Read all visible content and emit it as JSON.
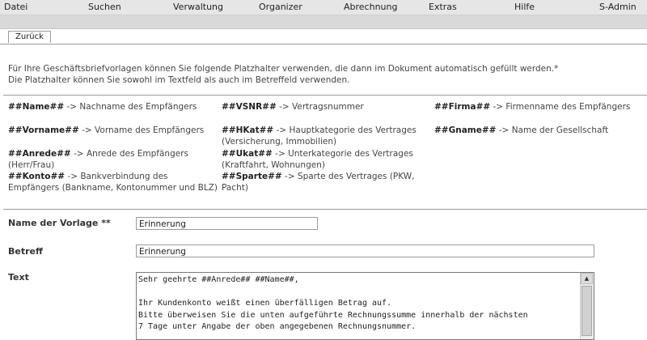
{
  "menu": {
    "items": [
      "Datei",
      "Suchen",
      "Verwaltung",
      "Organizer",
      "Abrechnung",
      "Extras",
      "Hilfe",
      "S-Admin"
    ]
  },
  "tabs": {
    "back_label": "Zurück"
  },
  "intro": {
    "line1": "Für Ihre Geschäftsbriefvorlagen können Sie folgende Platzhalter verwenden, die dann im Dokument automatisch gefüllt werden.*",
    "line2": "Die Platzhalter können Sie sowohl im Textfeld als auch im Betreffeld verwenden."
  },
  "placeholders": [
    {
      "key": "##Name##",
      "desc": " -> Nachname des Empfängers"
    },
    {
      "key": "##VSNR##",
      "desc": " -> Vertragsnummer"
    },
    {
      "key": "##Firma##",
      "desc": " -> Firmenname des Empfängers"
    },
    {
      "key": "##Vorname##",
      "desc": " -> Vorname des Empfängers"
    },
    {
      "key": "##HKat##",
      "desc": " -> Hauptkategorie des Vertrages (Versicherung, Immobilien)"
    },
    {
      "key": "##Gname##",
      "desc": " -> Name der Gesellschaft"
    },
    {
      "key": "##Anrede##",
      "desc": " -> Anrede des Empfängers (Herr/Frau)"
    },
    {
      "key": "##Ukat##",
      "desc": " -> Unterkategorie des Vertrages (Kraftfahrt, Wohnungen)"
    },
    {
      "key": "##Konto##",
      "desc": " -> Bankverbindung des Empfängers (Bankname, Kontonummer und BLZ)"
    },
    {
      "key": "##Sparte##",
      "desc": " -> Sparte des Vertrages (PKW, Pacht)"
    }
  ],
  "form": {
    "name_label": "Name der Vorlage **",
    "name_value": "Erinnerung",
    "subject_label": "Betreff",
    "subject_value": "Erinnerung",
    "text_label": "Text",
    "text_value": "Sehr geehrte ##Anrede## ##Name##,\n\nIhr Kundenkonto weißt einen überfälligen Betrag auf.\nBitte überweisen Sie die unten aufgeführte Rechnungssumme innerhalb der nächsten\n7 Tage unter Angabe der oben angegebenen Rechnungsnummer."
  },
  "icons": {
    "scroll_up": "triangle-up-icon"
  }
}
